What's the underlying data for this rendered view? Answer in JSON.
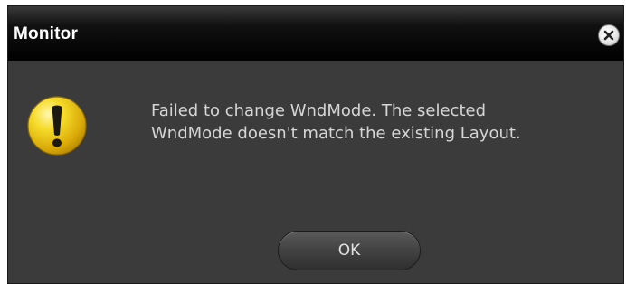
{
  "window": {
    "title": "Monitor",
    "close_icon": "close-icon"
  },
  "message": {
    "icon": "warning-icon",
    "line1": "Failed to change WndMode. The selected",
    "line2": "WndMode doesn't match the existing Layout."
  },
  "buttons": {
    "ok_label": "OK"
  },
  "colors": {
    "dialog_bg": "#3b3b3b",
    "titlebar_bg": "#000000",
    "text": "#d6d6d6",
    "warning_yellow": "#f2d21a"
  }
}
